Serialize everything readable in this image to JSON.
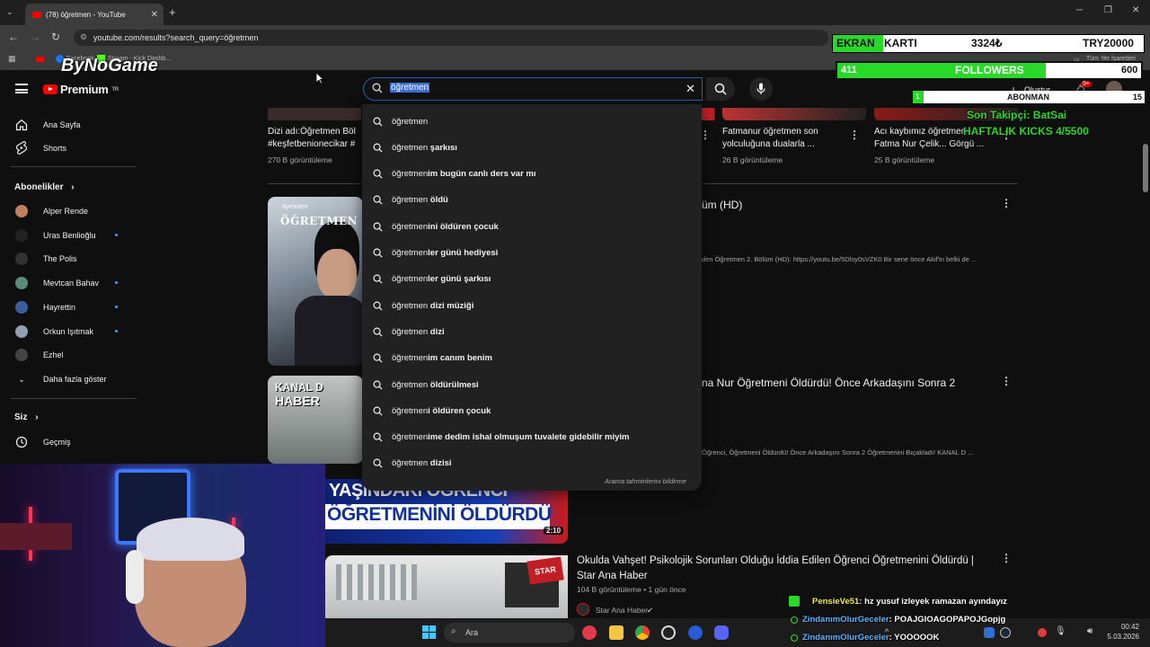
{
  "browser": {
    "tab_title": "(78) öğretmen - YouTube",
    "new_tab": "+",
    "url": "youtube.com/results?search_query=öğretmen",
    "bookmarks": [
      "Facebook",
      "Stream - Kick Dashb...",
      "Tüm Yer İşaretleri"
    ]
  },
  "youtube": {
    "logo_text": "Premium",
    "logo_region": "TR",
    "search_query": "öğretmen",
    "create_label": "Oluştur",
    "notif_badge": "9+"
  },
  "sidebar": {
    "main": [
      {
        "label": "Ana Sayfa",
        "icon": "home-icon"
      },
      {
        "label": "Shorts",
        "icon": "shorts-icon"
      }
    ],
    "subs_title": "Abonelikler",
    "subs": [
      {
        "label": "Alper Rende",
        "dot": false,
        "color": "#c08060"
      },
      {
        "label": "Uras Benlioğlu",
        "dot": true,
        "color": "#222222"
      },
      {
        "label": "The Polis",
        "dot": false,
        "color": "#333333"
      },
      {
        "label": "Mevtcan Bahav",
        "dot": true,
        "color": "#5a8a7a"
      },
      {
        "label": "Hayrettin",
        "dot": true,
        "color": "#3a5e9a"
      },
      {
        "label": "Orkun Işıtmak",
        "dot": true,
        "color": "#90a0b0"
      },
      {
        "label": "Ezhel",
        "dot": false,
        "color": "#444444"
      }
    ],
    "more": "Daha fazla göster",
    "you_title": "Siz",
    "history": "Geçmiş"
  },
  "top_videos": [
    {
      "title": "Dizi adı:Öğretmen Böl",
      "title2": "#keşfetbenionecikar #",
      "views": "270 B görüntüleme"
    },
    {
      "title": "Fatmanur öğretmen son",
      "title2": "yolculuğuna dualarla ...",
      "views": "26 B görüntüleme"
    },
    {
      "title": "Acı kaybımız öğretmen",
      "title2": "Fatma Nur Çelik... Görgü ...",
      "views": "25 B görüntüleme"
    }
  ],
  "results": [
    {
      "title_tail": "üm (HD)",
      "desc": "den Öğretmen 2. Bölüm (HD): https://youtu.be/5Dlsy0sVZK0 Bir sene önce Akif'in belki de ..."
    },
    {
      "title_tail": "na Nur Öğretmeni Öldürdü! Önce Arkadaşını Sonra 2",
      "desc": "Öğrenci, Öğretmeni Öldürdü! Önce Arkadaşını Sonra 2 Öğretmenini Bıçakladı! KANAL D ..."
    },
    {
      "title": "Okulda Vahşet! Psikolojik Sorunları Olduğu İddia Edilen Öğrenci Öğretmenini Öldürdü |",
      "title2": "Star Ana Haber",
      "views": "104 B görüntüleme • 1 gün önce",
      "channel": "Star Ana Haber"
    }
  ],
  "thumbs": {
    "ogretmen_tag": "#yeniden",
    "ogretmen_word": "ÖĞRETMEN",
    "kanald": "KANAL D",
    "haber": "HABER",
    "headline1": "YAŞINDAKİ ÖĞRENCİ",
    "headline2": "ÖĞRETMENİNİ ÖLDÜRDÜ",
    "duration": "2:10",
    "star": "STAR"
  },
  "suggestions": [
    {
      "typed": "öğretmen",
      "rest": ""
    },
    {
      "typed": "öğretmen",
      "rest": " şarkısı"
    },
    {
      "typed": "öğretmen",
      "rest": "im bugün canlı ders var mı"
    },
    {
      "typed": "öğretmen",
      "rest": " öldü"
    },
    {
      "typed": "öğretmen",
      "rest": "ini öldüren çocuk"
    },
    {
      "typed": "öğretmen",
      "rest": "ler günü hediyesi"
    },
    {
      "typed": "öğretmen",
      "rest": "ler günü şarkısı"
    },
    {
      "typed": "öğretmen",
      "rest": " dizi müziği"
    },
    {
      "typed": "öğretmen",
      "rest": " dizi"
    },
    {
      "typed": "öğretmen",
      "rest": "im canım benim"
    },
    {
      "typed": "öğretmen",
      "rest": " öldürülmesi"
    },
    {
      "typed": "öğretmen",
      "rest": "i öldüren çocuk"
    },
    {
      "typed": "öğretmen",
      "rest": "ime dedim ishal olmuşum tuvalete gidebilir miyim"
    },
    {
      "typed": "öğretmen",
      "rest": " dizisi"
    }
  ],
  "report_predictions": "Arama tahminlerini bildirme",
  "overlay": {
    "ekran": "EKRAN",
    "karti": "KARTI",
    "amount": "3324₺",
    "goal": "TRY20000",
    "followers_current": "411",
    "followers_label": "FOLLOWERS",
    "followers_goal": "600",
    "followers_progress": 0.685,
    "abonman_current": "1",
    "abonman_label": "ABONMAN",
    "abonman_goal": "15",
    "last_sub": "Son Takipçi: BatSai",
    "kicks": "HAFTALIK KICKS 4/5500"
  },
  "chat": [
    {
      "user": "PensieVe51",
      "msg": ": hz yusuf izleyek ramazan ayındayız",
      "color": "#f2ee4a"
    },
    {
      "user": "ZindanımOlurGeceler",
      "msg": ": POAJGIOAGOPAPOJGopjg",
      "color": "#5cb4ff"
    },
    {
      "user": "ZindanımOlurGeceler",
      "msg": ": YOOOOOK",
      "color": "#5cb4ff"
    }
  ],
  "taskbar": {
    "search_placeholder": "Ara",
    "time": "00:42",
    "date": "5.03.2026"
  }
}
